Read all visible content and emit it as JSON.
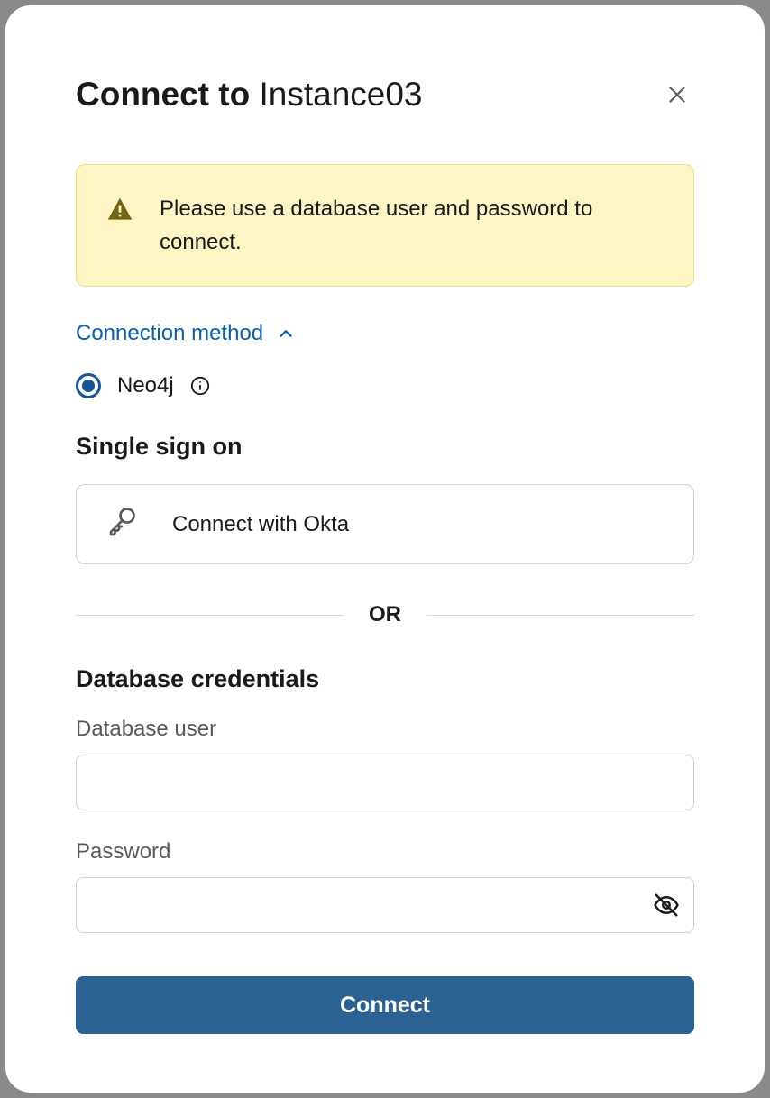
{
  "header": {
    "title_prefix": "Connect to ",
    "title_instance": "Instance03"
  },
  "alert": {
    "message": "Please use a database user and password to connect."
  },
  "connection_method": {
    "toggle_label": "Connection method",
    "options": {
      "neo4j": "Neo4j"
    }
  },
  "sso": {
    "heading": "Single sign on",
    "button_label": "Connect with Okta"
  },
  "divider": {
    "text": "OR"
  },
  "credentials": {
    "heading": "Database credentials",
    "user_label": "Database user",
    "user_value": "",
    "password_label": "Password",
    "password_value": ""
  },
  "actions": {
    "connect_label": "Connect"
  }
}
